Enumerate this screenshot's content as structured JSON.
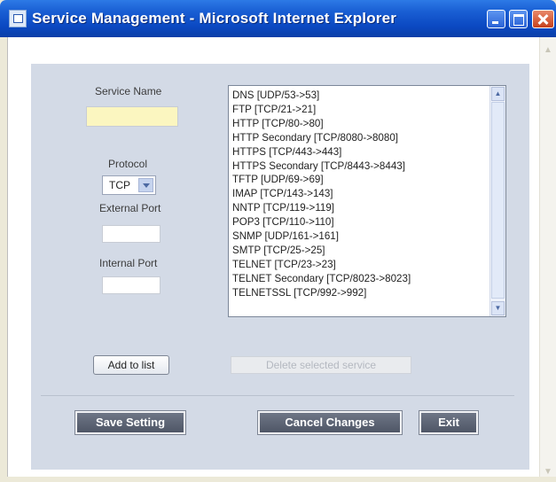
{
  "window": {
    "title": "Service Management - Microsoft Internet Explorer"
  },
  "form": {
    "service_name_label": "Service Name",
    "service_name_value": "",
    "protocol_label": "Protocol",
    "protocol_value": "TCP",
    "external_port_label": "External Port",
    "external_port_value": "",
    "internal_port_label": "Internal Port",
    "internal_port_value": "",
    "add_button": "Add to list"
  },
  "services": [
    "DNS [UDP/53->53]",
    "FTP [TCP/21->21]",
    "HTTP [TCP/80->80]",
    "HTTP Secondary [TCP/8080->8080]",
    "HTTPS [TCP/443->443]",
    "HTTPS Secondary [TCP/8443->8443]",
    "TFTP [UDP/69->69]",
    "IMAP [TCP/143->143]",
    "NNTP [TCP/119->119]",
    "POP3 [TCP/110->110]",
    "SNMP [UDP/161->161]",
    "SMTP [TCP/25->25]",
    "TELNET [TCP/23->23]",
    "TELNET Secondary [TCP/8023->8023]",
    "TELNETSSL [TCP/992->992]"
  ],
  "delete_button": "Delete selected service",
  "footer": {
    "save": "Save Setting",
    "cancel": "Cancel Changes",
    "exit": "Exit"
  },
  "icons": {
    "window": "ie-page-icon",
    "minimize": "minimize-icon",
    "maximize": "maximize-icon",
    "close": "close-icon"
  }
}
